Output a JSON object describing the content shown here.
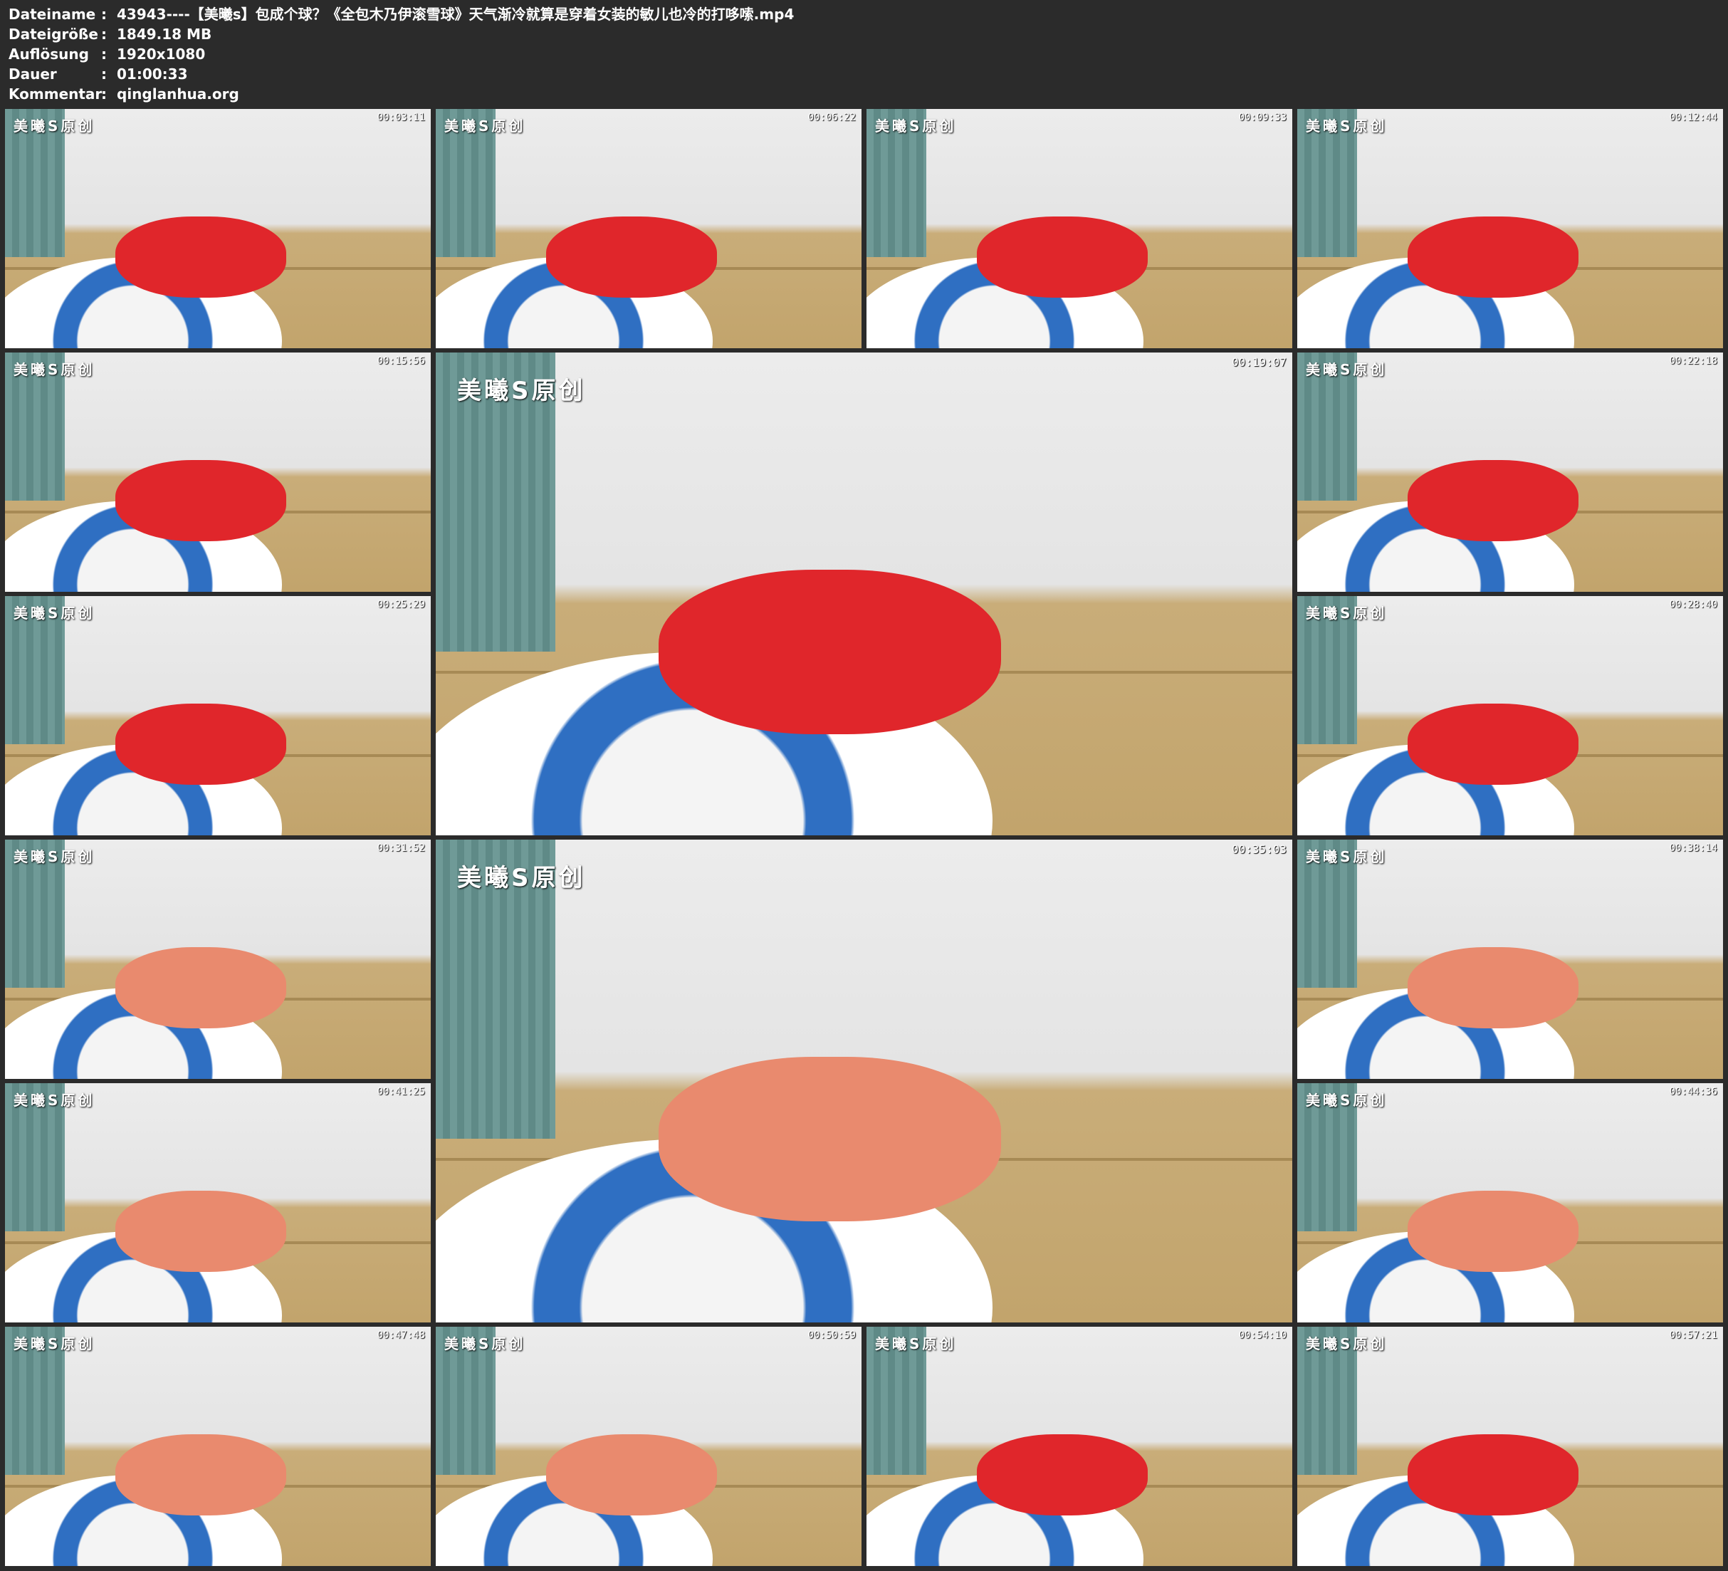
{
  "meta": {
    "rows": [
      {
        "key": "Dateiname",
        "sep": ":",
        "value": "43943----【美曦s】包成个球？《全包木乃伊滚雪球》天气渐冷就算是穿着女装的敏儿也冷的打哆嗦.mp4"
      },
      {
        "key": "Dateigröße",
        "sep": ":",
        "value": "1849.18 MB"
      },
      {
        "key": "Auflösung",
        "sep": ":",
        "value": "1920x1080"
      },
      {
        "key": "Dauer",
        "sep": ":",
        "value": "01:00:33"
      },
      {
        "key": "Kommentar",
        "sep": ":",
        "value": "qinglanhua.org"
      }
    ]
  },
  "watermark": "美曦S原创",
  "thumbs": [
    {
      "time": "00:03:11",
      "color": "#e0262b"
    },
    {
      "time": "00:06:22",
      "color": "#e0262b"
    },
    {
      "time": "00:09:33",
      "color": "#e0262b"
    },
    {
      "time": "00:12:44",
      "color": "#e0262b"
    },
    {
      "time": "00:15:56",
      "color": "#e0262b"
    },
    {
      "time": "00:19:07",
      "color": "#e0262b"
    },
    {
      "time": "00:22:18",
      "color": "#e0262b"
    },
    {
      "time": "00:25:29",
      "color": "#e0262b"
    },
    {
      "time": "00:28:40",
      "color": "#e0262b"
    },
    {
      "time": "00:31:52",
      "color": "#e98a6e"
    },
    {
      "time": "00:35:03",
      "color": "#e98a6e"
    },
    {
      "time": "00:38:14",
      "color": "#e98a6e"
    },
    {
      "time": "00:41:25",
      "color": "#e98a6e"
    },
    {
      "time": "00:44:36",
      "color": "#e98a6e"
    },
    {
      "time": "00:47:48",
      "color": "#e98a6e"
    },
    {
      "time": "00:50:59",
      "color": "#e98a6e"
    },
    {
      "time": "00:54:10",
      "color": "#e0262b"
    },
    {
      "time": "00:57:21",
      "color": "#e0262b"
    }
  ]
}
